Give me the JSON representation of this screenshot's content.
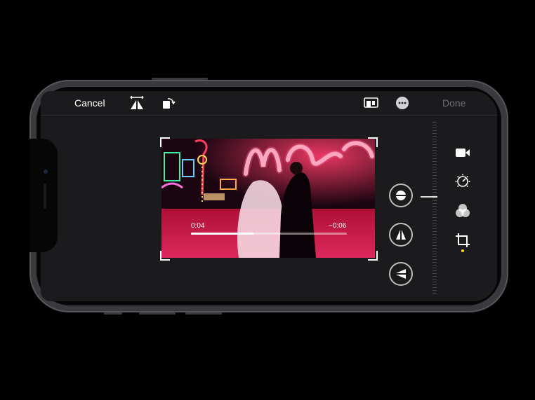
{
  "toolbar": {
    "cancel_label": "Cancel",
    "done_label": "Done",
    "left_icons": [
      "flip-horizontal-icon",
      "rotate-icon"
    ],
    "right_icons": [
      "aspect-ratio-icon",
      "more-icon"
    ]
  },
  "video": {
    "elapsed": "0:04",
    "remaining": "−0:06",
    "progress": 0.4
  },
  "adjust_buttons": [
    "straighten-icon",
    "vertical-perspective-icon",
    "horizontal-perspective-icon"
  ],
  "side_tools": [
    "video-icon",
    "adjust-icon",
    "filters-icon",
    "crop-icon"
  ],
  "colors": {
    "accent": "#ffd60a",
    "screen_bg": "#1b1b1d",
    "done_disabled": "#6e6e73"
  }
}
